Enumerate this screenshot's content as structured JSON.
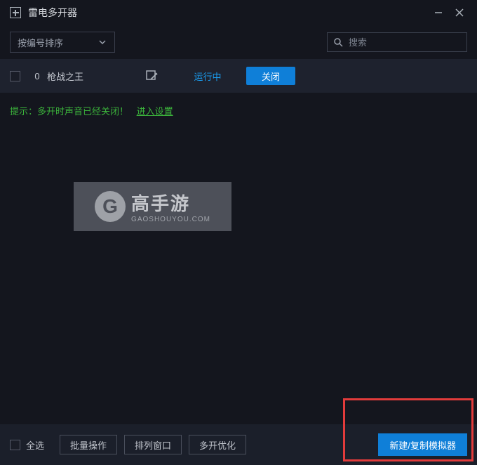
{
  "titlebar": {
    "title": "雷电多开器"
  },
  "topbar": {
    "sort_label": "按编号排序",
    "search_placeholder": "搜索"
  },
  "instances": [
    {
      "index": "0",
      "name": "枪战之王",
      "status": "运行中",
      "close_label": "关闭"
    }
  ],
  "hint": {
    "text": "提示：多开时声音已经关闭！",
    "link": "进入设置"
  },
  "watermark": {
    "brand": "高手游",
    "domain": "GAOSHOUYOU.COM"
  },
  "bottombar": {
    "select_all": "全选",
    "batch": "批量操作",
    "arrange": "排列窗口",
    "optimize": "多开优化",
    "create": "新建/复制模拟器"
  }
}
